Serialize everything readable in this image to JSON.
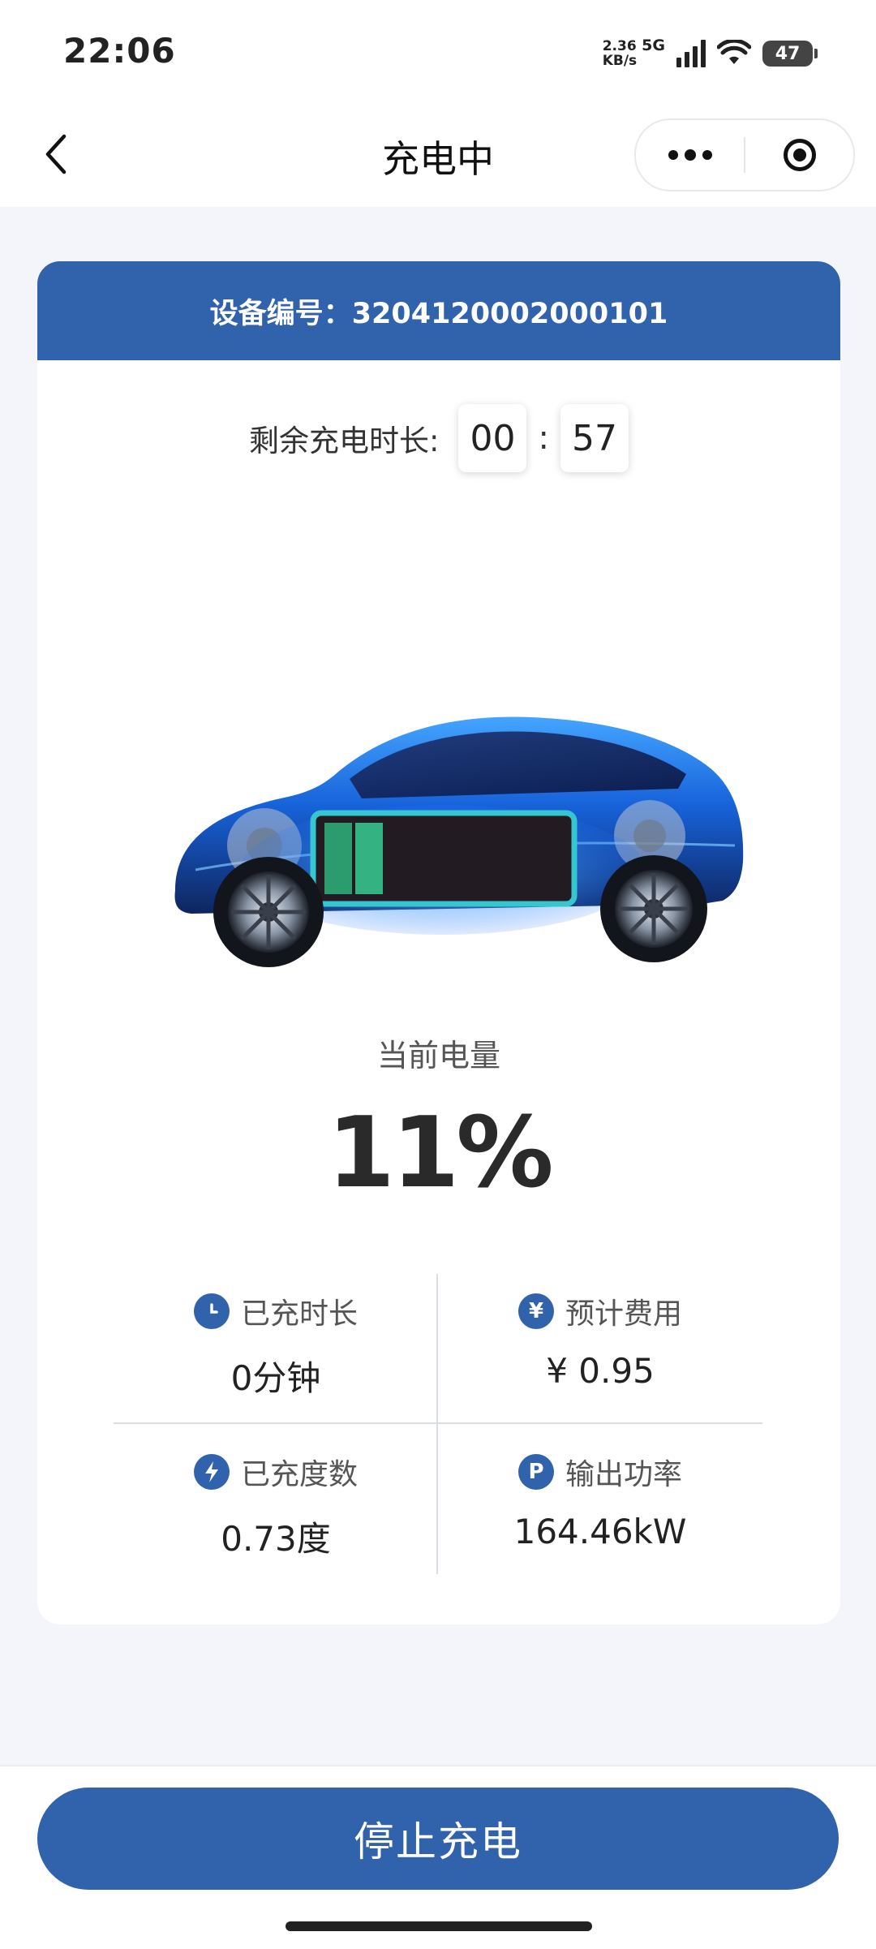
{
  "status_bar": {
    "time": "22:06",
    "net_speed": "2.36",
    "net_unit": "KB/s",
    "network": "5G",
    "battery": "47"
  },
  "nav": {
    "title": "充电中"
  },
  "device": {
    "label": "设备编号：3204120002000101"
  },
  "timer": {
    "label": "剩余充电时长:",
    "hours": "00",
    "separator": ":",
    "minutes": "57"
  },
  "charge": {
    "label": "当前电量",
    "percent": "11%"
  },
  "stats": [
    {
      "icon": "clock-icon",
      "label": "已充时长",
      "value": "0分钟"
    },
    {
      "icon": "yen-icon",
      "icon_glyph": "¥",
      "label": "预计费用",
      "value": "¥ 0.95"
    },
    {
      "icon": "bolt-icon",
      "label": "已充度数",
      "value": "0.73度"
    },
    {
      "icon": "power-icon",
      "icon_glyph": "P",
      "label": "输出功率",
      "value": "164.46kW"
    }
  ],
  "actions": {
    "stop_label": "停止充电"
  },
  "colors": {
    "primary": "#3162ac",
    "battery_fill": "#2fa77a",
    "background": "#f3f5fa"
  }
}
